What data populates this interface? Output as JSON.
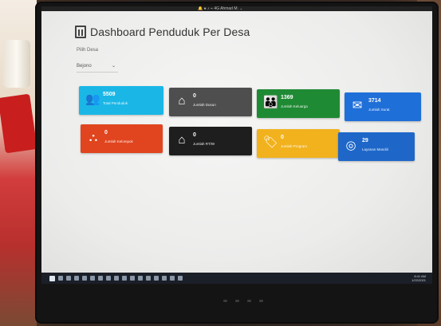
{
  "topbar": {
    "text": "🔔 ● ♪ ⌁ 4G  Ahmad M. ⌄"
  },
  "header": {
    "title": "Dashboard Penduduk Per Desa",
    "icon": "building-icon"
  },
  "filter": {
    "label": "Pilih Desa",
    "selected": "Bejono",
    "chevron": "⌄"
  },
  "cards": [
    {
      "number": "5509",
      "label": "Total Penduduk",
      "icon": "users-icon",
      "color": "#1ab7e6"
    },
    {
      "number": "0",
      "label": "Jumlah Dusun",
      "icon": "home-icon",
      "color": "#4e4e4e"
    },
    {
      "number": "1369",
      "label": "Jumlah Keluarga",
      "icon": "family-icon",
      "color": "#1f8a34"
    },
    {
      "number": "3714",
      "label": "Jumlah Surat",
      "icon": "mail-icon",
      "color": "#1f6fd8"
    },
    {
      "number": "0",
      "label": "Jumlah Kelompok",
      "icon": "sitemap-icon",
      "color": "#e0451f"
    },
    {
      "number": "0",
      "label": "Jumlah RT/W",
      "icon": "house-icon",
      "color": "#1e1e1e"
    },
    {
      "number": "0",
      "label": "Jumlah Program",
      "icon": "tag-icon",
      "color": "#f2b21d"
    },
    {
      "number": "29",
      "label": "Layanan Mandiri",
      "icon": "fingerprint-icon",
      "color": "#1e67c9"
    }
  ],
  "taskbar": {
    "time": "8:41 AM",
    "date": "1/22/2021"
  }
}
